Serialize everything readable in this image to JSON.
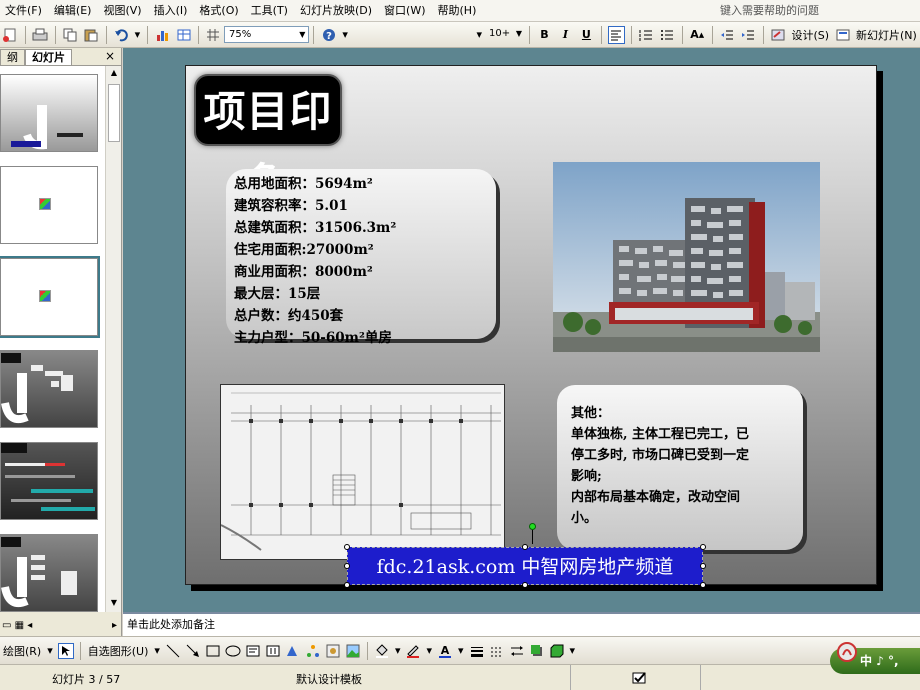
{
  "menu": {
    "items": [
      "文件(F)",
      "编辑(E)",
      "视图(V)",
      "插入(I)",
      "格式(O)",
      "工具(T)",
      "幻灯片放映(D)",
      "窗口(W)",
      "帮助(H)"
    ],
    "help_search": "键入需要帮助的问题"
  },
  "toolbar": {
    "zoom": "75%",
    "font_size": "10+",
    "bold": "B",
    "italic": "I",
    "underline": "U",
    "design_label": "设计(S)",
    "new_slide_label": "新幻灯片(N)"
  },
  "left_pane": {
    "tab_outline": "纲",
    "tab_slides": "幻灯片",
    "close": "×",
    "selected_index": 3
  },
  "slide": {
    "title": "项目印象",
    "stats": [
      "总用地面积：5694m²",
      "建筑容积率：5.01",
      "总建筑面积：31506.3m²",
      "住宅用面积:27000m²",
      "商业用面积：8000m²",
      "最大层：15层",
      "总户数：约450套",
      "主力户型：50-60m²单房"
    ],
    "other": [
      "其他：",
      "单体独栋, 主体工程已完工，已",
      "停工多时, 市场口碑已受到一定",
      "影响;",
      "内部布局基本确定，改动空间",
      "小。"
    ],
    "banner": "fdc.21ask.com 中智网房地产频道"
  },
  "notes": {
    "placeholder": "单击此处添加备注"
  },
  "drawing_toolbar": {
    "draw_label": "绘图(R)",
    "autoshapes_label": "自选图形(U)"
  },
  "status": {
    "slide_counter": "幻灯片 3 / 57",
    "design_template": "默认设计模板"
  },
  "ime": {
    "label": "中 ♪ °,"
  },
  "colors": {
    "workspace": "#5d8590",
    "banner": "#1d1dcc",
    "title_bg": "#000000"
  }
}
